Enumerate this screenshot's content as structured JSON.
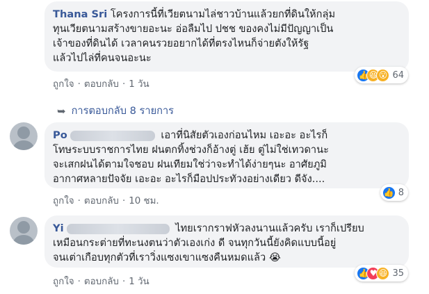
{
  "comments": [
    {
      "name": "Thana Sri",
      "lines": [
        "โครงการนี้ที่เวียตนามไล่ชาวบ้านแล้วยกที่ดินให้กลุ่ม",
        "ทุนเวียตนามสร้างขายอะนะ อ่อลืมไป ปชช ของคงไม่มีปัญญาเป็น",
        "เจ้าของที่ดินได้ เวลาคนรวยอยากได้ที่ตรงไหนก็จ่ายตังให้รัฐ",
        "แล้วไปไล่ที่คนจนอะนะ"
      ],
      "reaction_count": "64",
      "like_label": "ถูกใจ",
      "reply_label": "ตอบกลับ",
      "time": "1 วัน"
    },
    {
      "name_first": "Po",
      "lines": [
        "เอาที่นิสัยตัวเองก่อนไหม เอะอะ อะไรก็",
        "โทษระบบราชการไทย ฝนตกทิ้งช่วงก็อ้างตู่ เฮ้ย ตู่ไม่ใช่เทวดานะ",
        "จะเสกฝนได้ตามใจชอบ ฝนเทียมใช่ว่าจะทำได้ง่ายๆนะ อาศัยภูมิ",
        "อากาศหลายปัจจัย เอะอะ อะไรก็มือปประทัวงอย่างเดียว ดีจัง...."
      ],
      "reaction_count": "8",
      "like_label": "ถูกใจ",
      "reply_label": "ตอบกลับ",
      "time": "10 ชม."
    },
    {
      "name_first": "Yi",
      "lines": [
        "ไทยเรากราฟหัวลงนานแล้วครับ เราก็เปรียบ",
        "เหมือนกระต่ายที่ทะนงตนว่าตัวเองเก่ง ดี จนทุกวันนี้ยังคิดแบบนี้อยู่",
        "จนเต่าเกือบทุกตัวที่เราวิ่งแซงเขาแซงคืนหมดแล้ว"
      ],
      "reaction_count": "35",
      "like_label": "ถูกใจ",
      "reply_label": "ตอบกลับ",
      "time": "1 วัน"
    }
  ],
  "replies_link": "การตอบกลับ 8 รายการ",
  "icons": {
    "like": "like-icon",
    "haha": "haha-icon",
    "wow": "wow-icon",
    "love": "love-icon",
    "sad": "sad-icon",
    "reply_arrow": "reply-arrow-icon",
    "crying": "crying-emoji-icon"
  },
  "colors": {
    "name": "#385898",
    "bubble": "#f2f3f5",
    "meta": "#606770",
    "like": "#1877f2",
    "love": "#f33e58",
    "yellow": "#f7b125"
  }
}
